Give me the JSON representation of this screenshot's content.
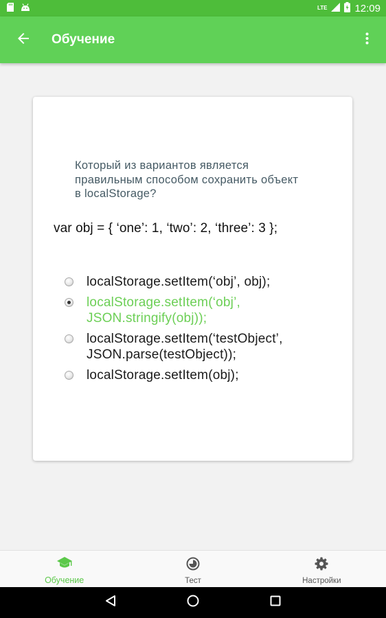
{
  "status_bar": {
    "time": "12:09",
    "network": "LTE",
    "icons": [
      "sd-card-icon",
      "android-icon",
      "signal-icon",
      "battery-icon"
    ]
  },
  "app_bar": {
    "title": "Обучение",
    "back_icon": "arrow-back-icon",
    "menu_icon": "more-vert-icon"
  },
  "card": {
    "question": "Который из вариантов является правильным способом сохранить объект в localStorage?",
    "code": "var obj = { ‘one’: 1, ‘two’: 2, ‘three’: 3 };",
    "options": [
      {
        "text": "localStorage.setItem(‘obj’, obj);",
        "selected": false,
        "correct": false
      },
      {
        "text": "localStorage.setItem(‘obj’, JSON.stringify(obj));",
        "selected": true,
        "correct": true
      },
      {
        "text": "localStorage.setItem(‘testObject’, JSON.parse(testObject));",
        "selected": false,
        "correct": false
      },
      {
        "text": "localStorage.setItem(obj);",
        "selected": false,
        "correct": false
      }
    ]
  },
  "bottom_nav": {
    "items": [
      {
        "label": "Обучение",
        "icon": "school-icon",
        "active": true
      },
      {
        "label": "Тест",
        "icon": "timelapse-icon",
        "active": false
      },
      {
        "label": "Настройки",
        "icon": "gear-icon",
        "active": false
      }
    ]
  },
  "colors": {
    "primary": "#60d157",
    "primary_dark": "#4ebd3a",
    "correct_text": "#6ccf56",
    "question_text": "#455a64"
  }
}
